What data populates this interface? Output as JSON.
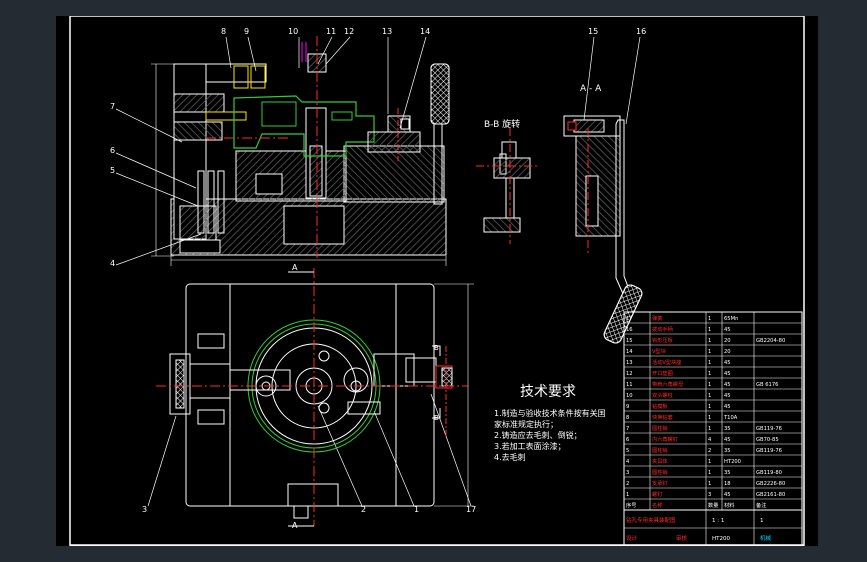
{
  "colors": {
    "window_background": "#242b33",
    "viewport_background": "#000000",
    "frame": "#ffffff",
    "outline": "#ffffff",
    "hatch": "#4a4a4a",
    "center_line": "#ff2a2a",
    "yellow": "#ffe600",
    "green": "#33cc33",
    "cyan": "#00d8ff",
    "blue": "#0000ff",
    "magenta": "#ff00ff"
  },
  "leaders": {
    "l1": "1",
    "l2": "2",
    "l3": "3",
    "l4": "4",
    "l5": "5",
    "l6": "6",
    "l7": "7",
    "l8": "8",
    "l9": "9",
    "l10": "10",
    "l11": "11",
    "l12": "12",
    "l13": "13",
    "l14": "14",
    "l15": "15",
    "l16": "16",
    "l17": "17"
  },
  "section_labels": {
    "bb": "B-B 旋转",
    "aa": "A - A",
    "cut_a_top": "A",
    "cut_a_bottom": "A",
    "cut_b_top": "B",
    "cut_b_bottom": "B"
  },
  "tech_requirements": {
    "title": "技术要求",
    "lines": [
      "1.制造与验收技术条件按有关国",
      "  家标准规定执行；",
      "2.铸造应去毛刺、倒锐；",
      "3.若加工表面涂漆；",
      "4.去毛刺"
    ]
  },
  "bom": {
    "rows": [
      {
        "no": "17",
        "name": "弹簧",
        "qty": "1",
        "mat": "65Mn",
        "std": ""
      },
      {
        "no": "16",
        "name": "拨动手柄",
        "qty": "1",
        "mat": "45",
        "std": ""
      },
      {
        "no": "15",
        "name": "钩形压板",
        "qty": "1",
        "mat": "20",
        "std": "GB2204-80"
      },
      {
        "no": "14",
        "name": "V型块",
        "qty": "1",
        "mat": "20",
        "std": ""
      },
      {
        "no": "13",
        "name": "活动V型块座",
        "qty": "1",
        "mat": "45",
        "std": ""
      },
      {
        "no": "12",
        "name": "开口垫圈",
        "qty": "1",
        "mat": "45",
        "std": ""
      },
      {
        "no": "11",
        "name": "带肩六角螺母",
        "qty": "1",
        "mat": "45",
        "std": "GB 6176"
      },
      {
        "no": "10",
        "name": "双头螺柱",
        "qty": "1",
        "mat": "45",
        "std": ""
      },
      {
        "no": "9",
        "name": "钻模板",
        "qty": "1",
        "mat": "45",
        "std": ""
      },
      {
        "no": "8",
        "name": "快换钻套",
        "qty": "1",
        "mat": "T10A",
        "std": ""
      },
      {
        "no": "7",
        "name": "圆柱销",
        "qty": "1",
        "mat": "35",
        "std": "GB119-76"
      },
      {
        "no": "6",
        "name": "内六角螺钉",
        "qty": "4",
        "mat": "45",
        "std": "GB70-85"
      },
      {
        "no": "5",
        "name": "圆柱销",
        "qty": "2",
        "mat": "35",
        "std": "GB119-76"
      },
      {
        "no": "4",
        "name": "夹具体",
        "qty": "1",
        "mat": "HT200",
        "std": ""
      },
      {
        "no": "3",
        "name": "圆柱销",
        "qty": "1",
        "mat": "35",
        "std": "GB119-80"
      },
      {
        "no": "2",
        "name": "支承钉",
        "qty": "1",
        "mat": "18",
        "std": "GB2226-80"
      },
      {
        "no": "1",
        "name": "螺钉",
        "qty": "3",
        "mat": "45",
        "std": "GB2161-80"
      },
      {
        "no": "序号",
        "name": "名称",
        "qty": "数量",
        "mat": "材料",
        "std": "备注"
      }
    ],
    "title_block": {
      "drawing_name": "钻孔专用夹具装配图",
      "scale": "1 : 1",
      "sheet_count": "1",
      "material": "HT200",
      "designer": "设计",
      "checker": "审核",
      "unit": "机械"
    }
  }
}
